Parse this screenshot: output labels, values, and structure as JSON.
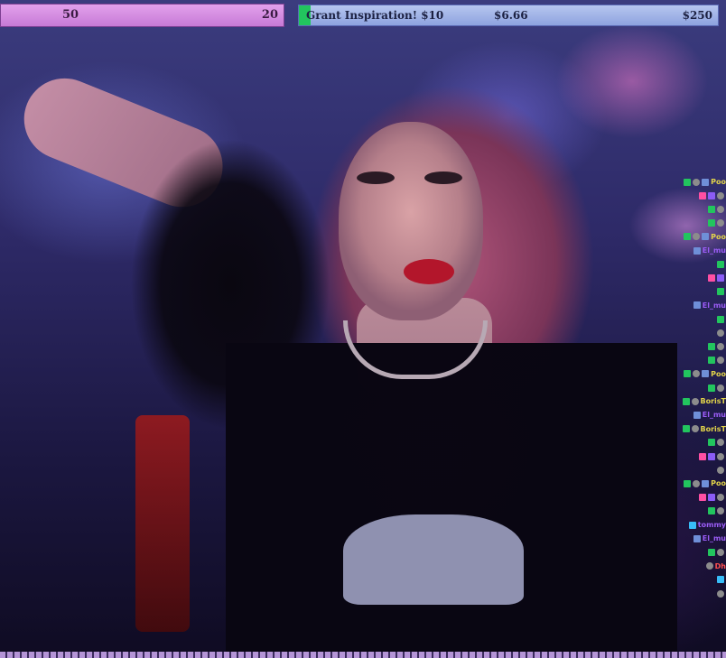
{
  "overlay": {
    "left_goal": {
      "value_a": "50",
      "value_b": "20"
    },
    "right_goal": {
      "title": "Grant Inspiration! $10",
      "current": "$6.66",
      "target": "$250",
      "progress_fraction": 0.027,
      "fill_color": "#22c55e"
    }
  },
  "chat": {
    "lines": [
      {
        "badges": [
          "b-green",
          "b-gray",
          "b-blue"
        ],
        "name": "Poo",
        "color": "#e2d44a"
      },
      {
        "badges": [
          "b-pink",
          "b-purple",
          "b-gray"
        ],
        "name": "",
        "color": "#e2d44a"
      },
      {
        "badges": [
          "b-green",
          "b-gray"
        ],
        "name": "",
        "color": "#e2d44a"
      },
      {
        "badges": [
          "b-green",
          "b-gray"
        ],
        "name": "",
        "color": "#e2d44a"
      },
      {
        "badges": [
          "b-green",
          "b-gray",
          "b-blue"
        ],
        "name": "Poo",
        "color": "#e2d44a"
      },
      {
        "badges": [
          "b-blue"
        ],
        "name": "El_mu",
        "color": "#9b5cf6"
      },
      {
        "badges": [
          "b-green"
        ],
        "name": "",
        "color": "#e2d44a"
      },
      {
        "badges": [
          "b-pink",
          "b-purple"
        ],
        "name": "",
        "color": "#e2d44a"
      },
      {
        "badges": [
          "b-green"
        ],
        "name": "",
        "color": "#e2d44a"
      },
      {
        "badges": [
          "b-blue"
        ],
        "name": "El_mu",
        "color": "#9b5cf6"
      },
      {
        "badges": [
          "b-green"
        ],
        "name": "",
        "color": "#e2d44a"
      },
      {
        "badges": [
          "b-gray"
        ],
        "name": "",
        "color": "#e2d44a"
      },
      {
        "badges": [
          "b-green",
          "b-gray"
        ],
        "name": "",
        "color": "#e2d44a"
      },
      {
        "badges": [
          "b-green",
          "b-gray"
        ],
        "name": "",
        "color": "#e2d44a"
      },
      {
        "badges": [
          "b-green",
          "b-gray",
          "b-blue"
        ],
        "name": "Poo",
        "color": "#e2d44a"
      },
      {
        "badges": [
          "b-green",
          "b-gray"
        ],
        "name": "",
        "color": "#e2d44a"
      },
      {
        "badges": [
          "b-green",
          "b-gray"
        ],
        "name": "BorisT",
        "color": "#e2d44a"
      },
      {
        "badges": [
          "b-blue"
        ],
        "name": "El_mu",
        "color": "#9b5cf6"
      },
      {
        "badges": [
          "b-green",
          "b-gray"
        ],
        "name": "BorisT",
        "color": "#e2d44a"
      },
      {
        "badges": [
          "b-green",
          "b-gray"
        ],
        "name": "",
        "color": "#e2d44a"
      },
      {
        "badges": [
          "b-pink",
          "b-purple",
          "b-gray"
        ],
        "name": "",
        "color": "#e2d44a"
      },
      {
        "badges": [
          "b-gray"
        ],
        "name": "",
        "color": "#e2d44a"
      },
      {
        "badges": [
          "b-green",
          "b-gray",
          "b-blue"
        ],
        "name": "Poo",
        "color": "#e2d44a"
      },
      {
        "badges": [
          "b-pink",
          "b-purple",
          "b-gray"
        ],
        "name": "",
        "color": "#e2d44a"
      },
      {
        "badges": [
          "b-green",
          "b-gray"
        ],
        "name": "",
        "color": "#e2d44a"
      },
      {
        "badges": [
          "b-cyan"
        ],
        "name": "tommy",
        "color": "#9b5cf6"
      },
      {
        "badges": [
          "b-blue"
        ],
        "name": "El_mu",
        "color": "#9b5cf6"
      },
      {
        "badges": [
          "b-green",
          "b-gray"
        ],
        "name": "",
        "color": "#e2d44a"
      },
      {
        "badges": [
          "b-gray"
        ],
        "name": "Dh",
        "color": "#ff4f4f"
      },
      {
        "badges": [
          "b-cyan"
        ],
        "name": "",
        "color": "#e2d44a"
      },
      {
        "badges": [
          "b-gray"
        ],
        "name": "",
        "color": "#e2d44a"
      }
    ]
  }
}
